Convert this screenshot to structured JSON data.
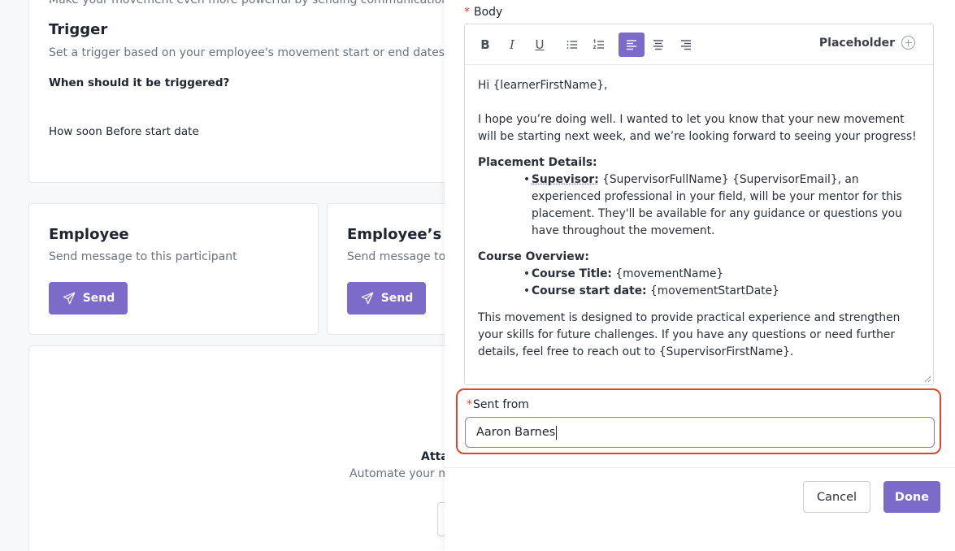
{
  "background": {
    "cut_text": "Make your movement even more powerful by sending communication",
    "trigger": {
      "title": "Trigger",
      "description": "Set a trigger based on your employee's movement start or end dates",
      "question": "When should it be triggered?",
      "value": "How soon Before start date"
    },
    "employee_card": {
      "title": "Employee",
      "description": "Send message to this participant",
      "send_label": "Send"
    },
    "supervisor_card": {
      "title": "Employee’s su",
      "description": "Send message to",
      "send_label": "Send"
    },
    "automate": {
      "title": "Atta",
      "description": "Automate your m"
    }
  },
  "drawer": {
    "body_label": "Body",
    "required_mark": "*",
    "toolbar": {
      "bold": "B",
      "italic": "I",
      "underline": "U",
      "placeholder_label": "Placeholder",
      "active_alignment": "left"
    },
    "content": {
      "greeting": "Hi {learnerFirstName},",
      "intro": "I hope you’re doing well. I wanted to let you know that your new movement will be starting next week, and we’re looking forward to seeing your progress!",
      "placement_title": "Placement Details:",
      "supervisor_label": "Supevisor:",
      "supervisor_text": " {SupervisorFullName} {SupervisorEmail}, an experienced professional in your field, will be your mentor for this placement. They'll be available for any guidance or questions you have throughout the movement.",
      "course_title": "Course Overview:",
      "course_title_label": "Course Title:",
      "course_title_value": " {movementName}",
      "course_start_label": "Course start date:",
      "course_start_value": " {movementStartDate}",
      "closing": "This movement is designed to provide practical experience and strengthen your skills for future challenges. If you have any questions or need further details, feel free to reach out to {SupervisorFirstName}."
    },
    "sent_from": {
      "label": "Sent from",
      "value": "Aaron Barnes"
    },
    "buttons": {
      "cancel": "Cancel",
      "done": "Done"
    },
    "colors": {
      "accent": "#7c6bc8",
      "highlight": "#e0452f"
    }
  }
}
